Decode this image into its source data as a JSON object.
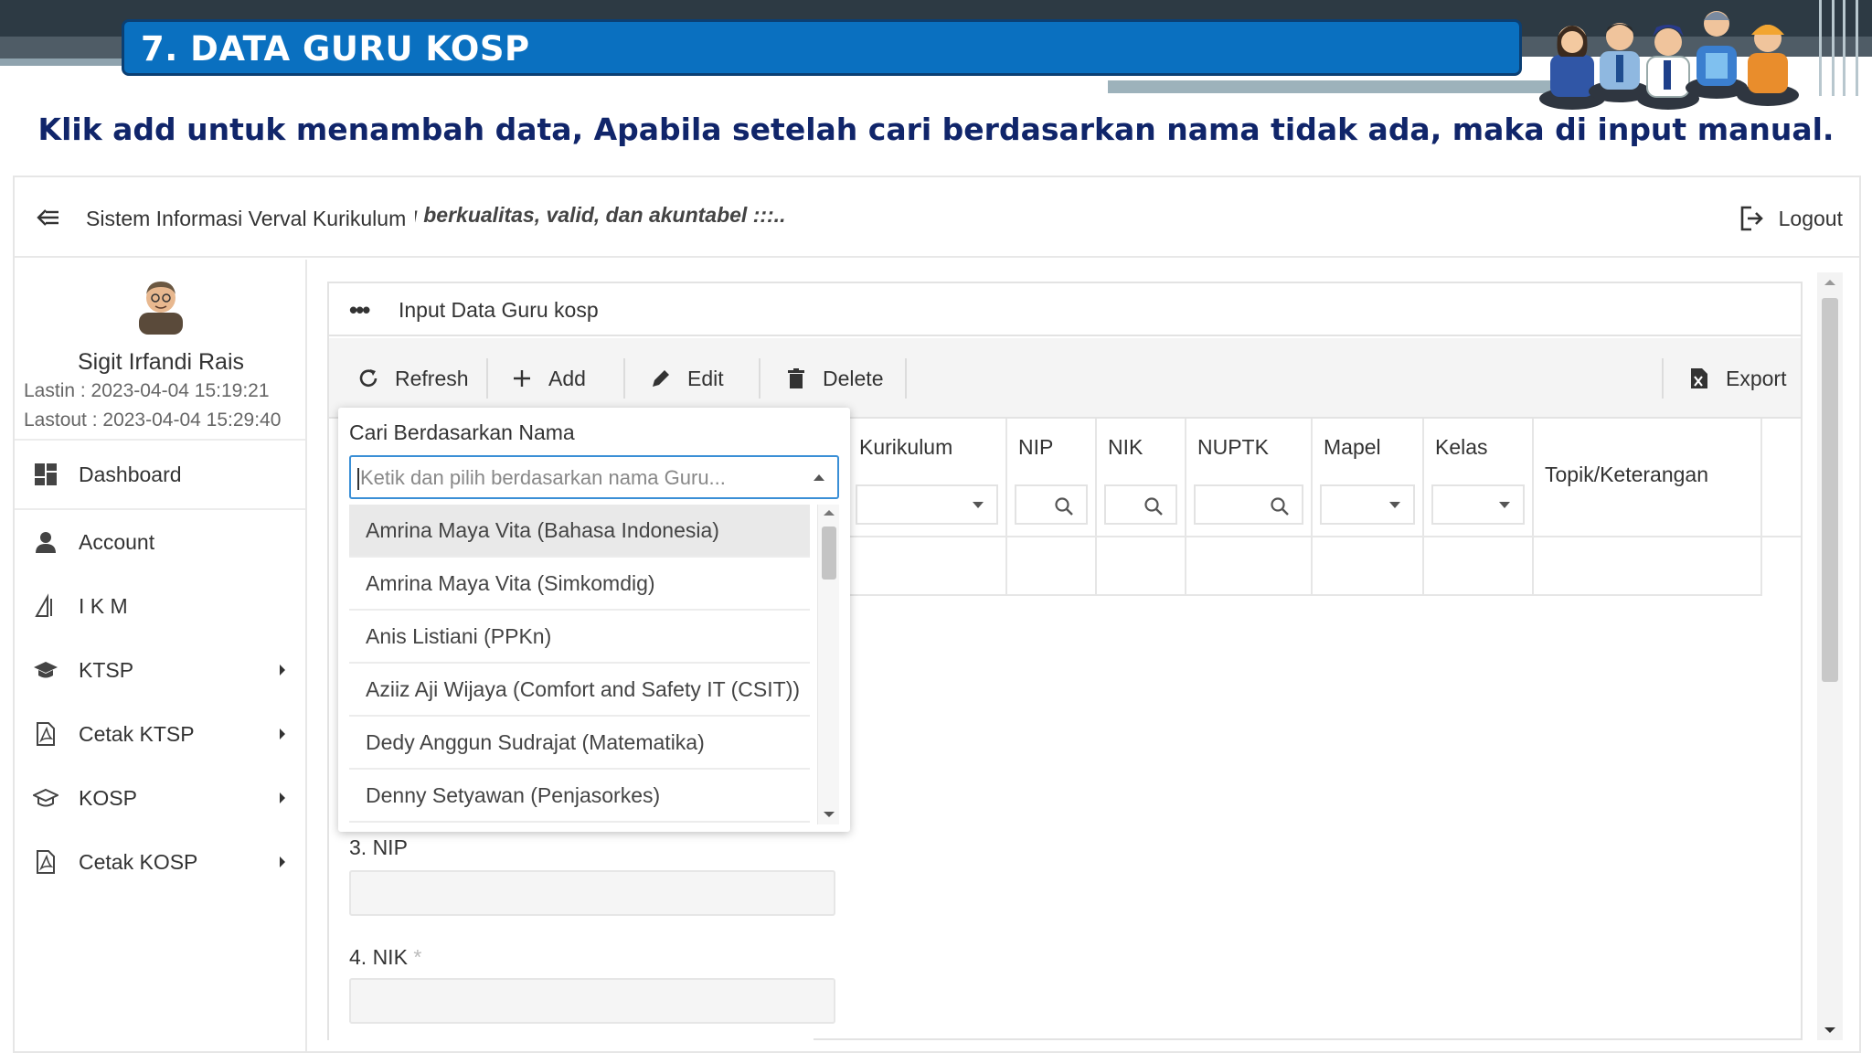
{
  "slide": {
    "title": "7. DATA GURU KOSP",
    "subtitle": "Klik add untuk menambah data, Apabila setelah cari berdasarkan nama tidak ada, maka di input manual.",
    "colors": {
      "title_bar": "#0a70c0",
      "subtitle_text": "#10256a"
    }
  },
  "app": {
    "title": "Sistem Informasi Verval Kurikulum",
    "marquee": "::: Mari wujudkan data yang berkualitas, valid, dan akuntabel :::..",
    "logout_label": "Logout"
  },
  "user": {
    "name": "Sigit Irfandi Rais",
    "lastin": "Lastin : 2023-04-04 15:19:21",
    "lastout": "Lastout : 2023-04-04 15:29:40"
  },
  "sidebar": {
    "items": [
      {
        "label": "Dashboard",
        "icon": "dashboard-icon"
      },
      {
        "label": "Account",
        "icon": "user-icon"
      },
      {
        "label": "I K M",
        "icon": "ikm-icon"
      },
      {
        "label": "KTSP",
        "icon": "graduation-cap-icon"
      },
      {
        "label": "Cetak KTSP",
        "icon": "pdf-icon"
      },
      {
        "label": "KOSP",
        "icon": "graduation-cap-outline-icon"
      },
      {
        "label": "Cetak KOSP",
        "icon": "pdf-icon"
      }
    ]
  },
  "panel": {
    "title": "Input Data Guru kosp"
  },
  "toolbar": {
    "refresh": "Refresh",
    "add": "Add",
    "edit": "Edit",
    "delete": "Delete",
    "export": "Export"
  },
  "grid": {
    "columns": [
      "Kurikulum",
      "NIP",
      "NIK",
      "NUPTK",
      "Mapel",
      "Kelas",
      "Topik/Keterangan"
    ]
  },
  "form": {
    "nip_label": "3. NIP",
    "nik_label": "4. NIK"
  },
  "search_popup": {
    "label": "Cari Berdasarkan Nama",
    "placeholder": "Ketik dan pilih berdasarkan nama Guru...",
    "options": [
      "Amrina Maya Vita (Bahasa Indonesia)",
      "Amrina Maya Vita (Simkomdig)",
      "Anis Listiani (PPKn)",
      "Aziiz Aji Wijaya (Comfort and Safety IT (CSIT))",
      "Dedy Anggun Sudrajat (Matematika)",
      "Denny Setyawan (Penjasorkes)"
    ]
  }
}
